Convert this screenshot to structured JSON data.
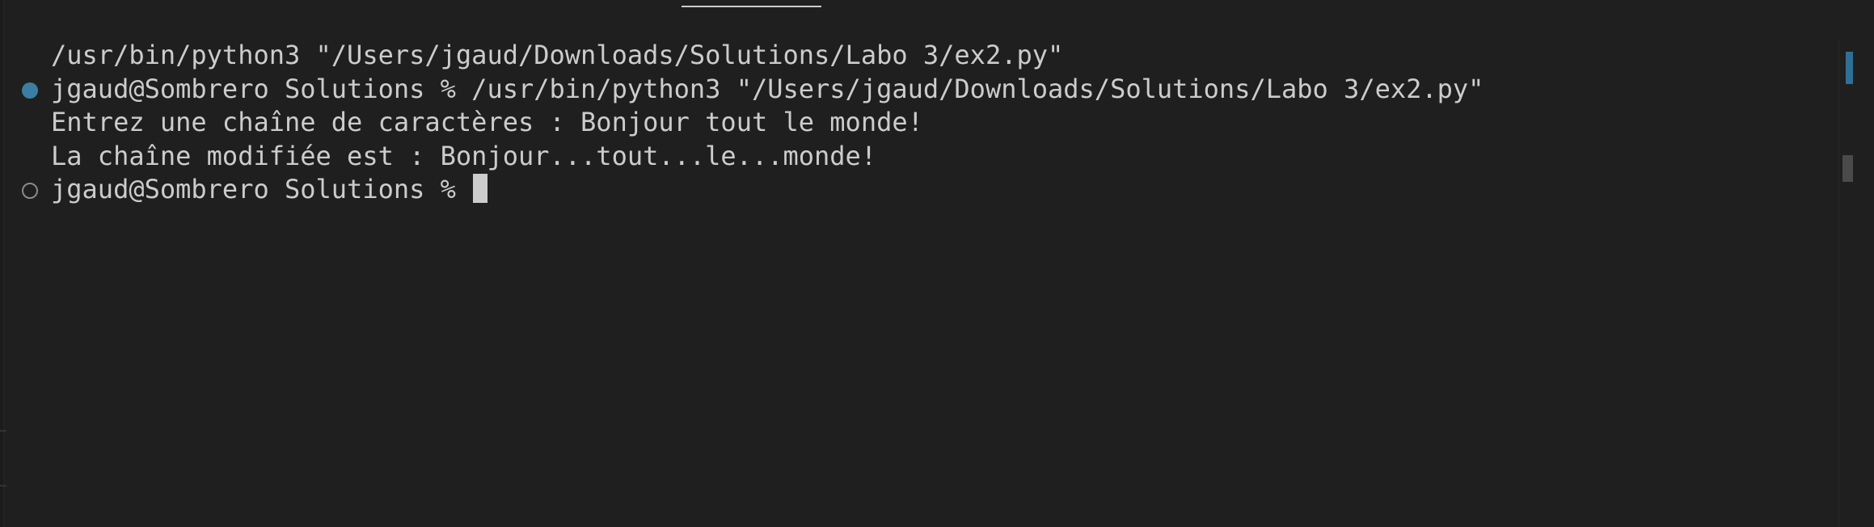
{
  "terminal": {
    "lines": [
      {
        "text": "/usr/bin/python3 \"/Users/jgaud/Downloads/Solutions/Labo 3/ex2.py\"",
        "decoration": "none"
      },
      {
        "text": "jgaud@Sombrero Solutions % /usr/bin/python3 \"/Users/jgaud/Downloads/Solutions/Labo 3/ex2.py\"",
        "decoration": "success"
      },
      {
        "text": "Entrez une chaîne de caractères : Bonjour tout le monde!",
        "decoration": "none"
      },
      {
        "text": "La chaîne modifiée est : Bonjour...tout...le...monde!",
        "decoration": "none"
      },
      {
        "text": "jgaud@Sombrero Solutions % ",
        "decoration": "empty",
        "cursor": true
      }
    ],
    "colors": {
      "background": "#1f1f1f",
      "foreground": "#cccccc",
      "success_decoration": "#3b7ea1",
      "empty_decoration": "#8a8a8a",
      "scrollbar_marker": "#2f6f96"
    },
    "icons": {
      "success_decoration": "filled-circle-icon",
      "empty_decoration": "hollow-circle-icon"
    }
  }
}
